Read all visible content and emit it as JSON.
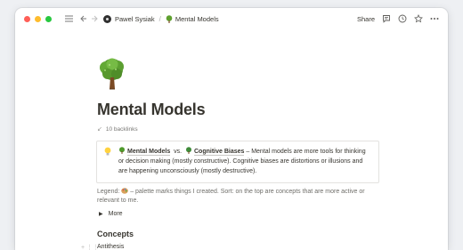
{
  "topbar": {
    "breadcrumb": {
      "user": "Pawel Sysiak",
      "separator": "/",
      "page": "Mental Models"
    },
    "share_label": "Share",
    "icons": [
      "menu-icon",
      "back-icon",
      "forward-icon",
      "comment-icon",
      "updates-icon",
      "clock-icon",
      "star-icon",
      "more-icon"
    ]
  },
  "page": {
    "icon": "tree-icon",
    "title": "Mental Models",
    "backlinks": "10 backlinks",
    "callout": {
      "icon": "lightbulb-icon",
      "link1": "Mental Models",
      "vs": "vs.",
      "link2": "Cognitive Biases",
      "text": " – Mental models are more tools for thinking or decision making (mostly constructive). Cognitive biases are distortions or illusions and are happening unconsciously (mostly destructive)."
    },
    "legend": {
      "prefix": "Legend: ",
      "text": " – palette marks things I created. Sort: on the top are concepts that are more active or relevant to me."
    },
    "more_label": "More",
    "section_heading": "Concepts",
    "first_item": "Antithesis"
  },
  "colors": {
    "title": "#37352f",
    "muted": "#787774",
    "border": "#e3e2e0"
  }
}
